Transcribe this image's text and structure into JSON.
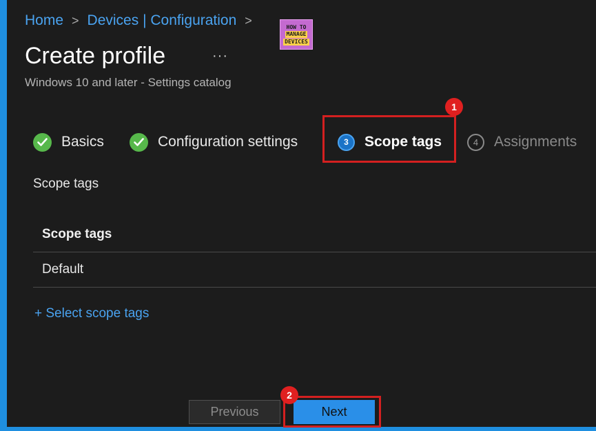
{
  "breadcrumb": {
    "items": [
      "Home",
      "Devices | Configuration"
    ],
    "separator": ">"
  },
  "logo": {
    "line1": "HOW TO",
    "line2": "MANAGE",
    "line3": "DEVICES"
  },
  "header": {
    "title": "Create profile",
    "more": "···",
    "subtitle": "Windows 10 and later - Settings catalog"
  },
  "steps": [
    {
      "label": "Basics",
      "state": "complete"
    },
    {
      "label": "Configuration settings",
      "state": "complete"
    },
    {
      "number": "3",
      "label": "Scope tags",
      "state": "current"
    },
    {
      "number": "4",
      "label": "Assignments",
      "state": "pending"
    }
  ],
  "annotations": {
    "badge1": "1",
    "badge2": "2",
    "highlight_color": "#d42020"
  },
  "main": {
    "section_label": "Scope tags",
    "table": {
      "header": "Scope tags",
      "rows": [
        "Default"
      ]
    },
    "add_link": "+ Select scope tags"
  },
  "footer": {
    "previous_label": "Previous",
    "next_label": "Next"
  },
  "colors": {
    "accent": "#2a8fe8",
    "link": "#4aa3f0",
    "success": "#57b84b",
    "background": "#1c1c1c"
  }
}
